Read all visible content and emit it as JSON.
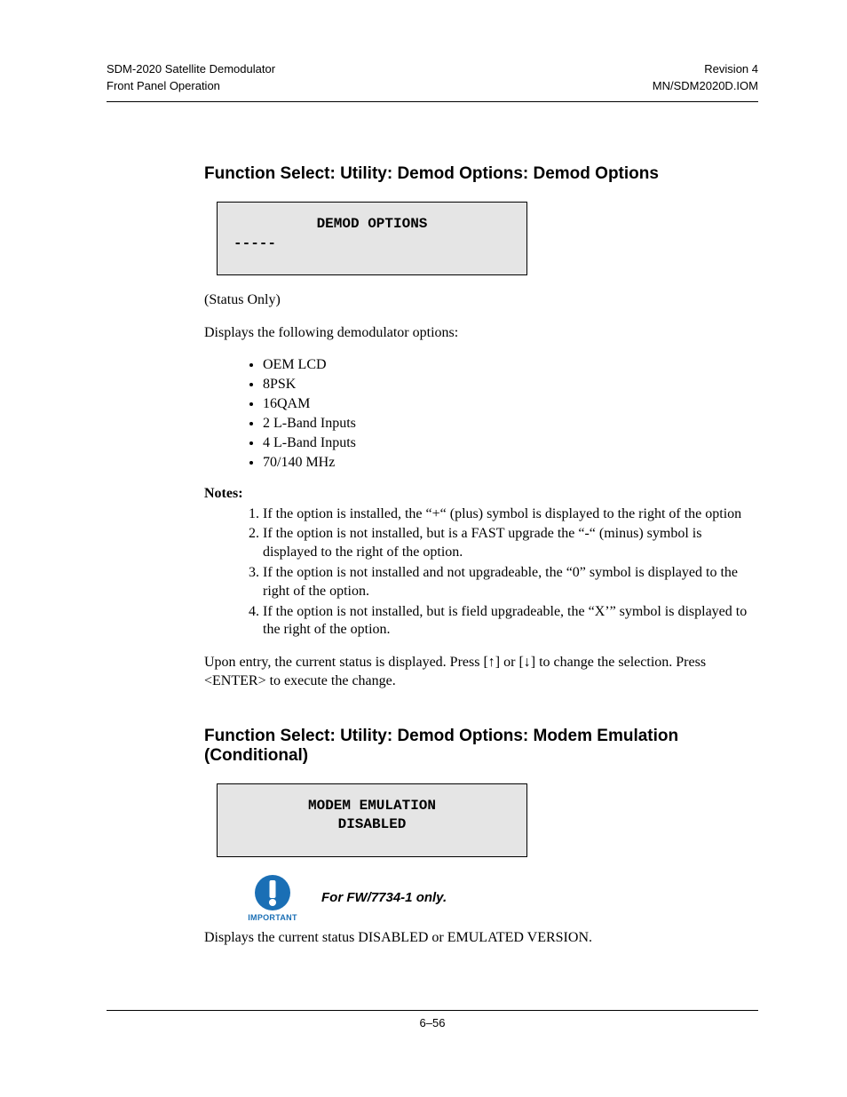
{
  "header": {
    "left1": "SDM-2020 Satellite Demodulator",
    "left2": "Front Panel Operation",
    "right1": "Revision 4",
    "right2": "MN/SDM2020D.IOM"
  },
  "section1": {
    "heading": "Function Select: Utility: Demod Options: Demod Options",
    "lcd_line1": "DEMOD OPTIONS",
    "lcd_line2": "-----",
    "status_only": "(Status Only)",
    "intro": "Displays the following demodulator options:",
    "options": [
      "OEM LCD",
      "8PSK",
      "16QAM",
      "2 L-Band Inputs",
      "4 L-Band Inputs",
      "70/140 MHz"
    ],
    "notes_label": "Notes:",
    "notes": [
      "If the option is installed, the “+“ (plus) symbol is displayed to the right of the option",
      "If the option is not installed, but is a FAST upgrade the “-“ (minus) symbol is displayed to the right of the option.",
      "If the option is not installed and not upgradeable, the “0” symbol is displayed to the right of the option.",
      "If the option is not installed, but is field upgradeable, the “X’” symbol is displayed to the right of the option."
    ],
    "closing": "Upon entry, the current status is displayed. Press [↑] or [↓] to change the selection. Press <ENTER> to execute the change."
  },
  "section2": {
    "heading": "Function Select: Utility: Demod Options: Modem Emulation (Conditional)",
    "lcd_line1": "MODEM EMULATION",
    "lcd_line2": "DISABLED",
    "important_label": "IMPORTANT",
    "important_text": "For FW/7734-1 only.",
    "closing": "Displays the current status DISABLED or EMULATED VERSION."
  },
  "footer": {
    "page": "6–56"
  }
}
